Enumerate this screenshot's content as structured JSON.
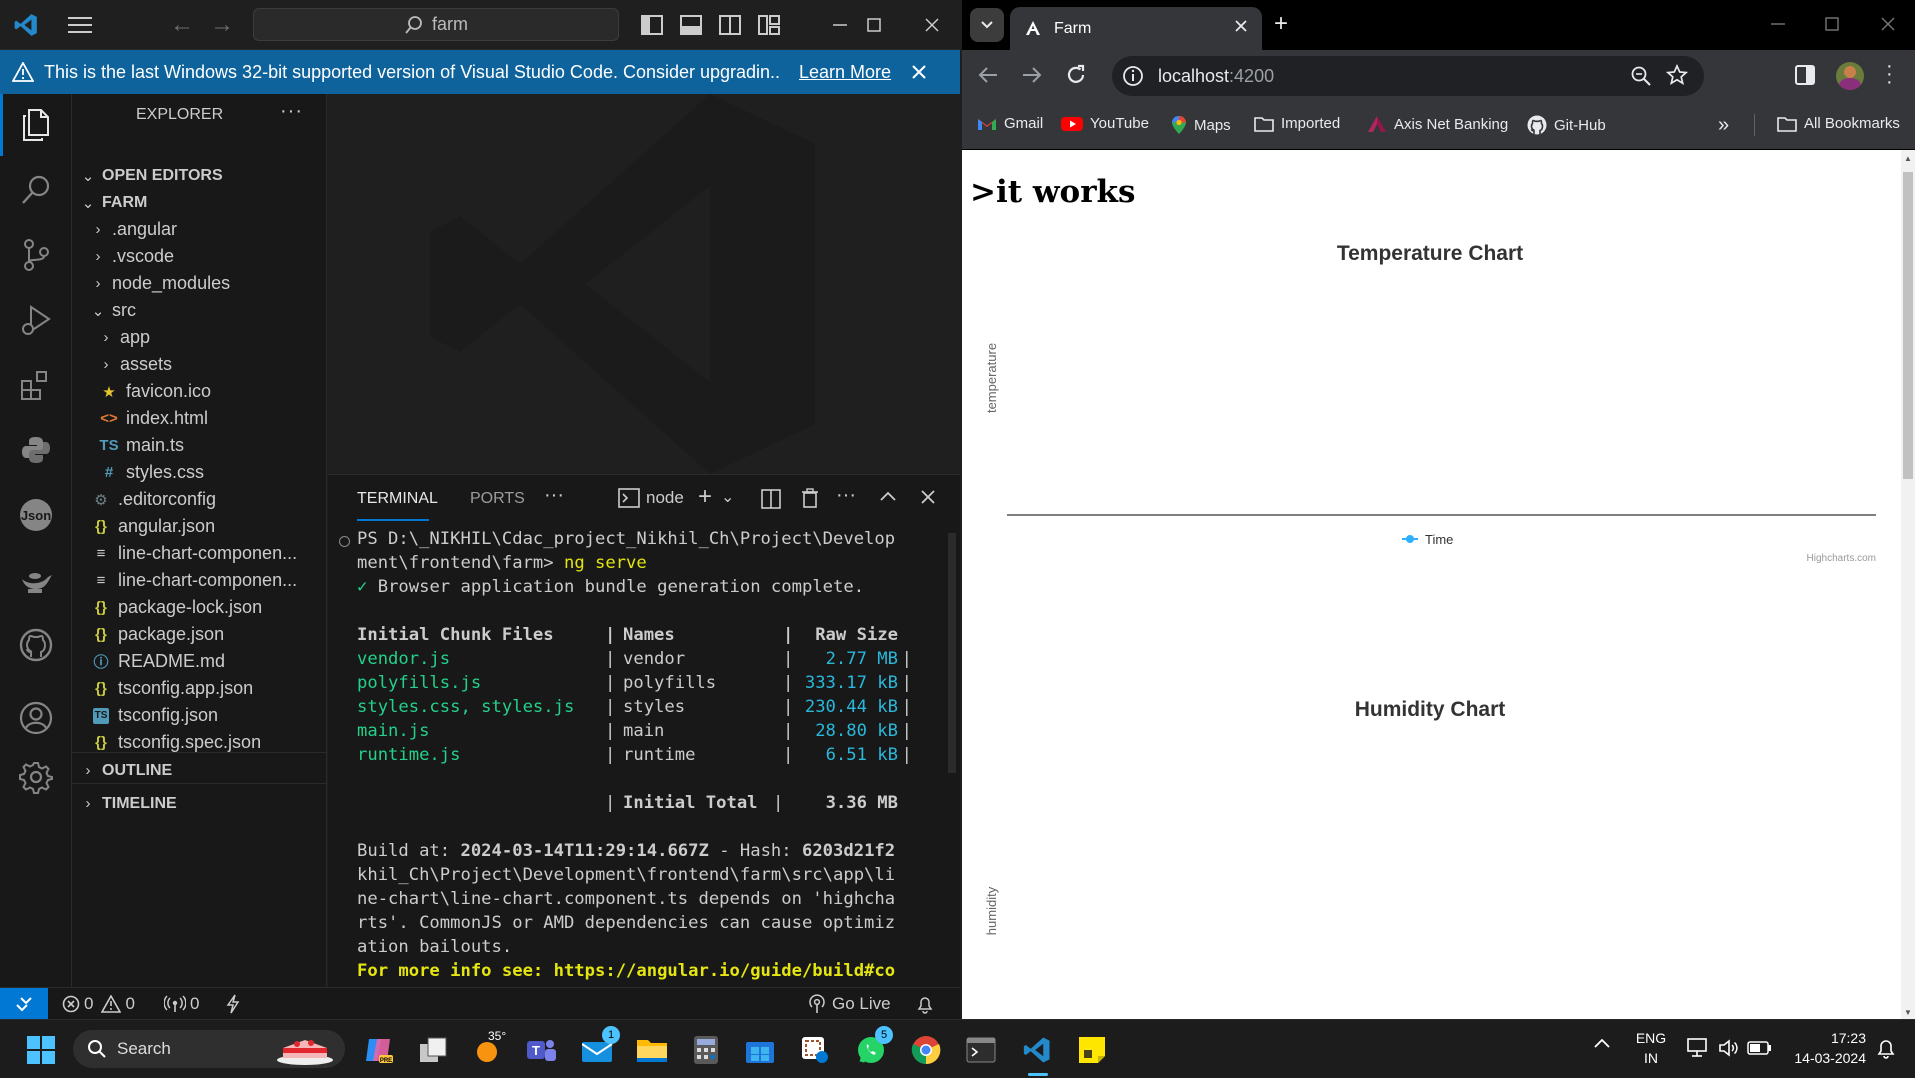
{
  "vscode": {
    "search_text": "farm",
    "notice": {
      "text": "This is the last Windows 32-bit supported version of Visual Studio Code. Consider upgradin...",
      "link": "Learn More"
    },
    "explorer": {
      "title": "EXPLORER",
      "open_editors": "OPEN EDITORS",
      "project": "FARM",
      "items": [
        {
          "label": ".angular",
          "type": "folder",
          "depth": 1,
          "expanded": false
        },
        {
          "label": ".vscode",
          "type": "folder",
          "depth": 1,
          "expanded": false
        },
        {
          "label": "node_modules",
          "type": "folder",
          "depth": 1,
          "expanded": false
        },
        {
          "label": "src",
          "type": "folder",
          "depth": 1,
          "expanded": true
        },
        {
          "label": "app",
          "type": "folder",
          "depth": 2,
          "expanded": false
        },
        {
          "label": "assets",
          "type": "folder",
          "depth": 2,
          "expanded": false
        },
        {
          "label": "favicon.ico",
          "type": "favicon",
          "depth": 2
        },
        {
          "label": "index.html",
          "type": "html",
          "depth": 2
        },
        {
          "label": "main.ts",
          "type": "ts",
          "depth": 2
        },
        {
          "label": "styles.css",
          "type": "css",
          "depth": 2
        },
        {
          "label": ".editorconfig",
          "type": "gear",
          "depth": 1
        },
        {
          "label": "angular.json",
          "type": "json",
          "depth": 1
        },
        {
          "label": "line-chart-componen...",
          "type": "text",
          "depth": 1
        },
        {
          "label": "line-chart-componen...",
          "type": "text",
          "depth": 1
        },
        {
          "label": "package-lock.json",
          "type": "json",
          "depth": 1
        },
        {
          "label": "package.json",
          "type": "json",
          "depth": 1
        },
        {
          "label": "README.md",
          "type": "info",
          "depth": 1
        },
        {
          "label": "tsconfig.app.json",
          "type": "json",
          "depth": 1
        },
        {
          "label": "tsconfig.json",
          "type": "tsconfig",
          "depth": 1
        },
        {
          "label": "tsconfig.spec.json",
          "type": "json",
          "depth": 1
        }
      ],
      "outline": "OUTLINE",
      "timeline": "TIMELINE"
    },
    "terminal": {
      "tab_terminal": "TERMINAL",
      "tab_ports": "PORTS",
      "shell": "node",
      "prompt": "PS D:\\_NIKHIL\\Cdac_project_Nikhil_Ch\\Project\\Develop",
      "prompt2": "ment\\frontend\\farm> ",
      "command": "ng serve",
      "success": "Browser application bundle generation complete.",
      "header": {
        "files": "Initial Chunk Files",
        "names": "Names",
        "size": "Raw Size"
      },
      "chunks": [
        {
          "file": "vendor.js",
          "name": "vendor",
          "size": "2.77 MB"
        },
        {
          "file": "polyfills.js",
          "name": "polyfills",
          "size": "333.17 kB"
        },
        {
          "file": "styles.css, styles.js",
          "name": "styles",
          "size": "230.44 kB"
        },
        {
          "file": "main.js",
          "name": "main",
          "size": "28.80 kB"
        },
        {
          "file": "runtime.js",
          "name": "runtime",
          "size": "6.51 kB"
        }
      ],
      "total_label": "Initial Total",
      "total_size": "3.36 MB",
      "build_prefix": "Build at: ",
      "build_time": "2024-03-14T11:29:14.667Z",
      "hash_prefix": " - Hash: ",
      "hash": "6203d21f2",
      "warn1": "khil_Ch\\Project\\Development\\frontend\\farm\\src\\app\\li",
      "warn2": "ne-chart\\line-chart.component.ts depends on 'highcha",
      "warn3": "rts'. CommonJS or AMD dependencies can cause optimiz",
      "warn4": "ation bailouts.",
      "more_info": "For more info see: https://angular.io/guide/build#co"
    },
    "status": {
      "errors": "0",
      "warnings": "0",
      "ports": "0",
      "go_live": "Go Live"
    }
  },
  "chrome": {
    "tab_title": "Farm",
    "url_host": "localhost",
    "url_port": ":4200",
    "bookmarks": [
      "Gmail",
      "YouTube",
      "Maps",
      "Imported",
      "Axis Net Banking",
      "Git-Hub"
    ],
    "all_bookmarks": "All Bookmarks",
    "page": {
      "heading": ">it works",
      "temperature_chart": {
        "title": "Temperature Chart",
        "ylabel": "temperature",
        "legend": "Time",
        "credit": "Highcharts.com"
      },
      "humidity_chart": {
        "title": "Humidity Chart",
        "ylabel": "humidity"
      }
    }
  },
  "chart_data": [
    {
      "type": "line",
      "title": "Temperature Chart",
      "ylabel": "temperature",
      "xlabel": "",
      "series": [
        {
          "name": "Time",
          "values": []
        }
      ],
      "legend": "bottom-center",
      "color": "#2caffe"
    },
    {
      "type": "line",
      "title": "Humidity Chart",
      "ylabel": "humidity",
      "xlabel": "",
      "series": []
    }
  ],
  "taskbar": {
    "search": "Search",
    "weather": "35°",
    "teams_badge": "1",
    "mail_badge": "1",
    "whatsapp_badge": "5",
    "lang_top": "ENG",
    "lang_bottom": "IN",
    "time": "17:23",
    "date": "14-03-2024"
  },
  "colors": {
    "vscode_bg": "#1f1f1f",
    "notice_blue": "#0e639c",
    "terminal_green": "#23d18b",
    "terminal_cyan": "#29b8db",
    "terminal_yellow": "#e5e510",
    "chrome_dark": "#35363a",
    "highcharts_blue": "#2caffe"
  }
}
